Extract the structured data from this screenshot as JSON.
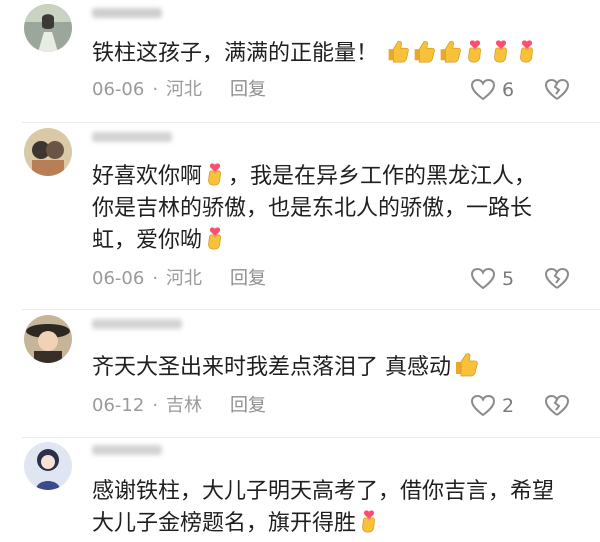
{
  "comments": [
    {
      "text": "铁柱这孩子，满满的正能量！",
      "emoji_suffix": [
        "thumbs-up",
        "thumbs-up",
        "thumbs-up",
        "finger-heart",
        "finger-heart",
        "finger-heart"
      ],
      "date": "06-06",
      "location": "河北",
      "reply_label": "回复",
      "like_count": "6",
      "show_count": true
    },
    {
      "text_lines": [
        "好喜欢你啊",
        "，我是在异乡工作的黑龙江人，",
        "你是吉林的骄傲，也是东北人的骄傲，一路长",
        "虹，爱你呦"
      ],
      "date": "06-06",
      "location": "河北",
      "reply_label": "回复",
      "like_count": "5",
      "show_count": true
    },
    {
      "text": "齐天大圣出来时我差点落泪了 真感动",
      "date": "06-12",
      "location": "吉林",
      "reply_label": "回复",
      "like_count": "2",
      "show_count": true
    },
    {
      "text_lines": [
        "感谢铁柱，大儿子明天高考了，借你吉言，希望",
        "大儿子金榜题名，旗开得胜"
      ],
      "date": "",
      "location": "",
      "reply_label": "",
      "like_count": "",
      "show_count": false
    }
  ],
  "icons": {
    "like": "heart-outline-icon",
    "dislike": "broken-heart-outline-icon",
    "thumbs_up": "thumbs-up-emoji",
    "finger_heart": "finger-heart-emoji"
  },
  "colors": {
    "text": "#1f1f1f",
    "meta": "#9a9a9a",
    "emoji_yellow": "#f7c23a",
    "emoji_heart": "#ff4d6d"
  }
}
